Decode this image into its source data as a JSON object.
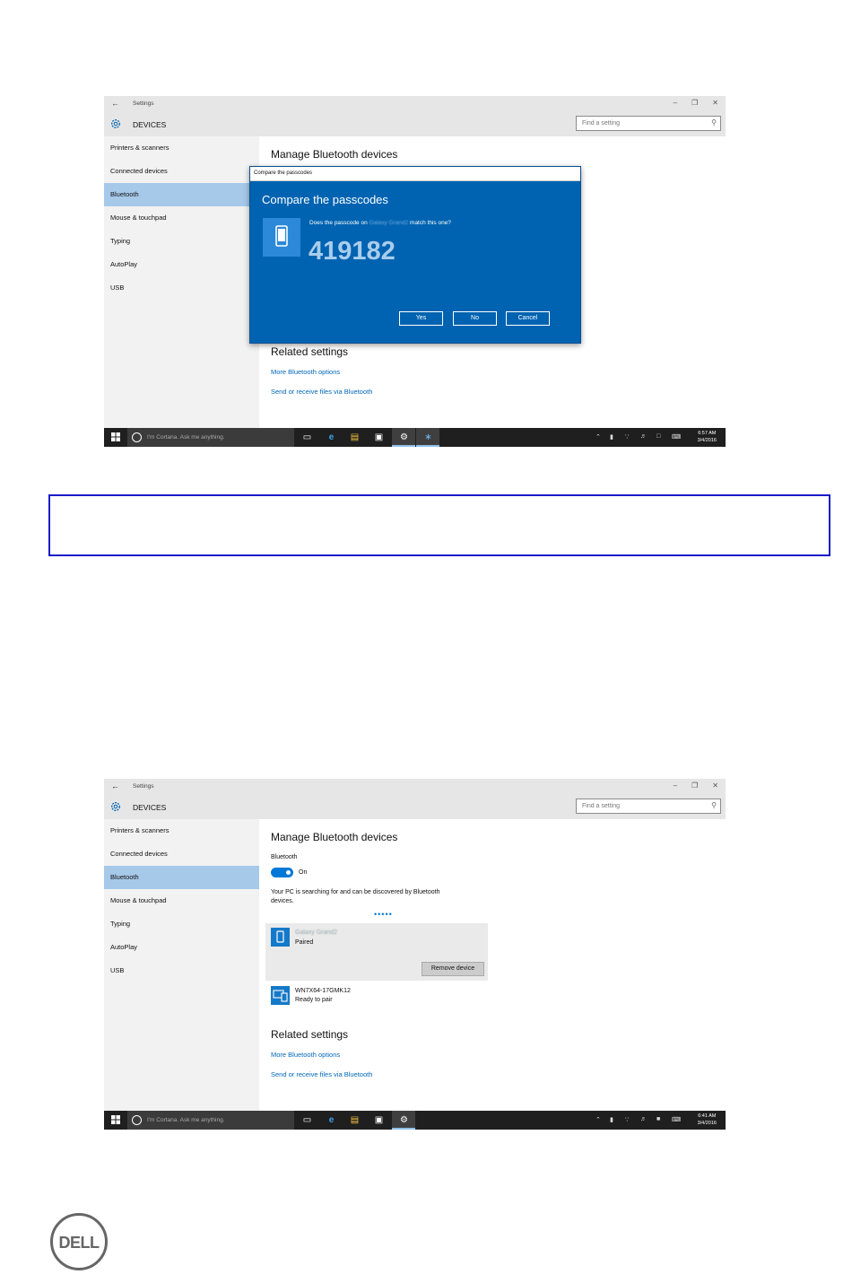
{
  "screenshot1": {
    "window_title": "Settings",
    "header_title": "DEVICES",
    "search_placeholder": "Find a setting",
    "sidebar": [
      "Printers & scanners",
      "Connected devices",
      "Bluetooth",
      "Mouse & touchpad",
      "Typing",
      "AutoPlay",
      "USB"
    ],
    "active_item": "Bluetooth",
    "heading": "Manage Bluetooth devices",
    "related_heading": "Related settings",
    "links": [
      "More Bluetooth options",
      "Send or receive files via Bluetooth"
    ],
    "dialog": {
      "bar_title": "Compare the passcodes",
      "title": "Compare the passcodes",
      "question_prefix": "Does the passcode on",
      "device_name": "Galaxy Grand2",
      "question_suffix": "match this one?",
      "passcode": "419182",
      "buttons": [
        "Yes",
        "No",
        "Cancel"
      ]
    },
    "taskbar": {
      "cortana": "I'm Cortana. Ask me anything.",
      "time": "6:57 AM",
      "date": "3/4/2016"
    }
  },
  "screenshot2": {
    "window_title": "Settings",
    "header_title": "DEVICES",
    "search_placeholder": "Find a setting",
    "sidebar": [
      "Printers & scanners",
      "Connected devices",
      "Bluetooth",
      "Mouse & touchpad",
      "Typing",
      "AutoPlay",
      "USB"
    ],
    "active_item": "Bluetooth",
    "heading": "Manage Bluetooth devices",
    "bluetooth_label": "Bluetooth",
    "toggle_state": "On",
    "searching_text_line1": "Your PC is searching for and can be discovered by Bluetooth",
    "searching_text_line2": "devices.",
    "devices": [
      {
        "name": "Galaxy Grand2",
        "status": "Paired",
        "action": "Remove device"
      },
      {
        "name": "WN7X64-17GMK12",
        "status": "Ready to pair"
      }
    ],
    "related_heading": "Related settings",
    "links": [
      "More Bluetooth options",
      "Send or receive files via Bluetooth"
    ],
    "taskbar": {
      "cortana": "I'm Cortana. Ask me anything.",
      "time": "6:41 AM",
      "date": "3/4/2016"
    }
  },
  "colors": {
    "accent": "#0078d7",
    "dialog": "#0063b1",
    "note_border": "#1b1bc8"
  },
  "logo": "DELL"
}
